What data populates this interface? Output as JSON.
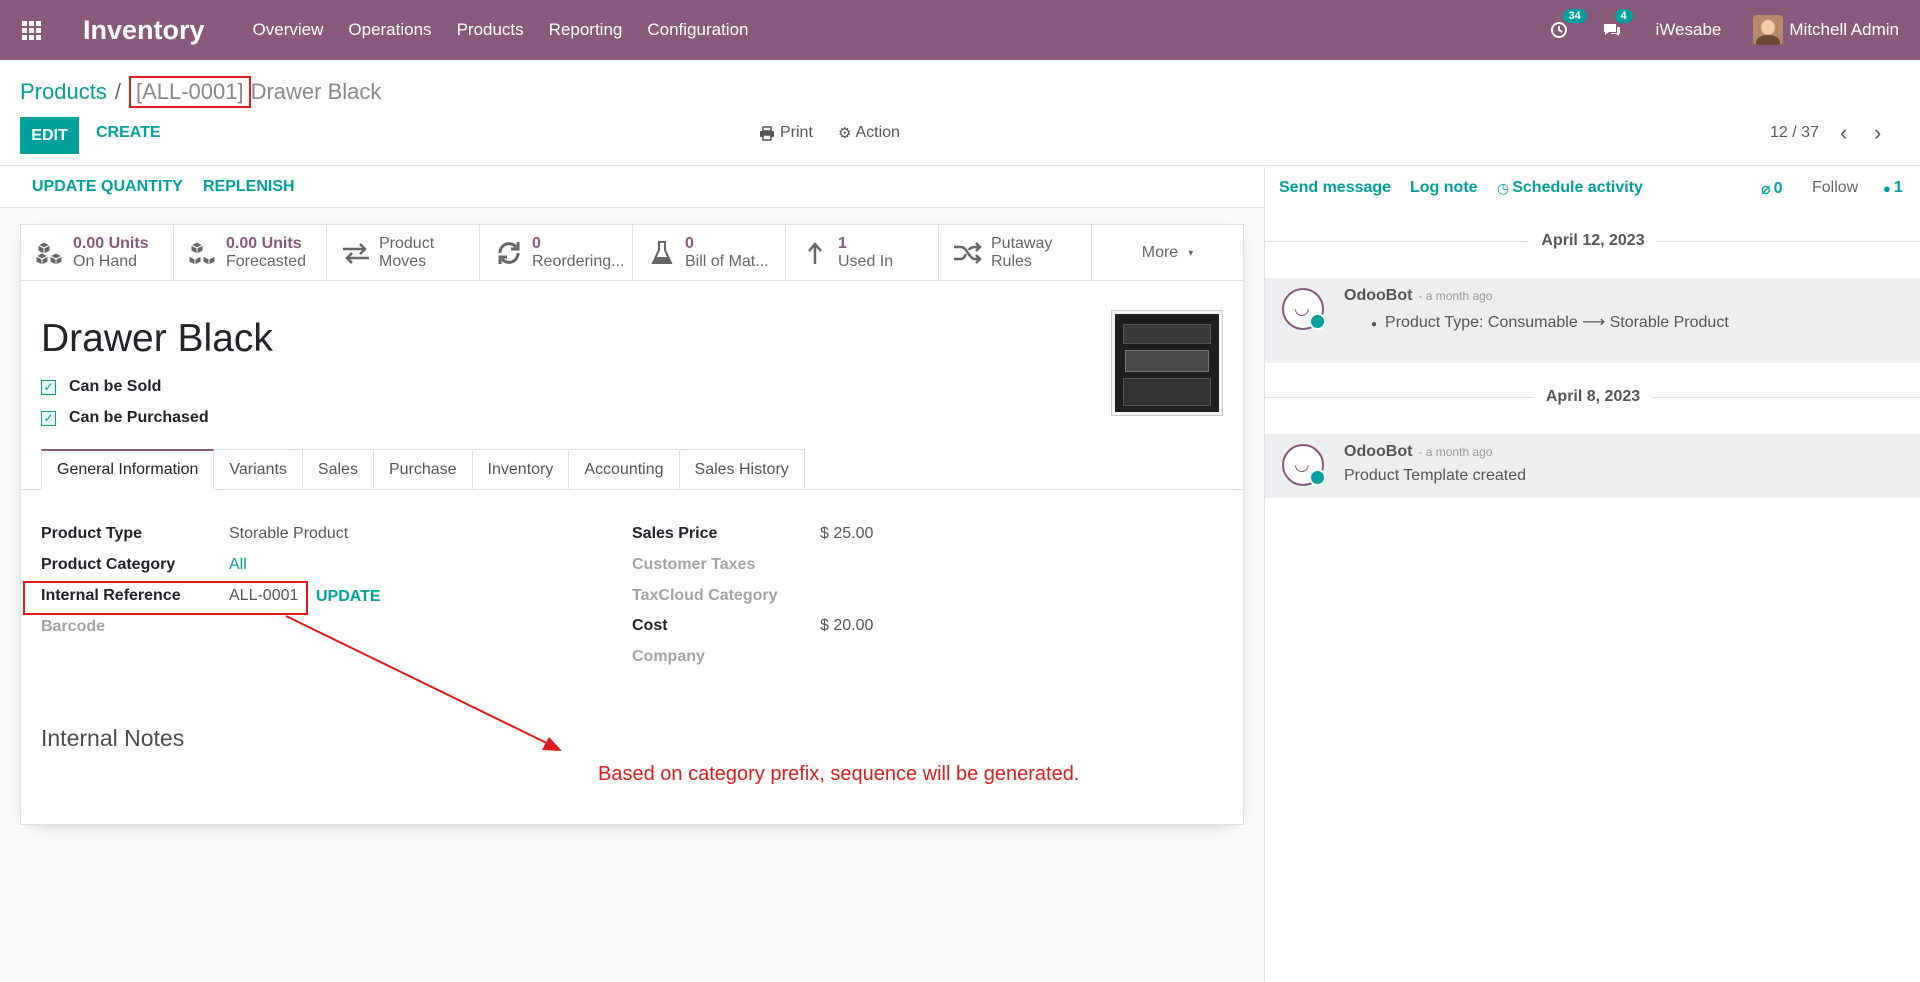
{
  "navbar": {
    "brand": "Inventory",
    "menu": [
      "Overview",
      "Operations",
      "Products",
      "Reporting",
      "Configuration"
    ],
    "activity_count": "34",
    "message_count": "4",
    "company": "iWesabe",
    "user": "Mitchell Admin"
  },
  "breadcrumb": {
    "parent": "Products",
    "separator": "/",
    "reference": "[ALL-0001]",
    "name": "Drawer Black"
  },
  "toolbar": {
    "edit": "EDIT",
    "create": "CREATE",
    "print": "Print",
    "action": "Action",
    "pager": "12 / 37"
  },
  "statusbar": {
    "update_quantity": "UPDATE QUANTITY",
    "replenish": "REPLENISH"
  },
  "smart_buttons": [
    {
      "value": "0.00 Units",
      "label": "On Hand",
      "icon": "cubes-icon"
    },
    {
      "value": "0.00 Units",
      "label": "Forecasted",
      "icon": "cubes-icon"
    },
    {
      "value": "Product",
      "label": "Moves",
      "icon": "exchange-icon"
    },
    {
      "value": "0",
      "label": "Reordering...",
      "icon": "refresh-icon"
    },
    {
      "value": "0",
      "label": "Bill of Mat...",
      "icon": "flask-icon"
    },
    {
      "value": "1",
      "label": "Used In",
      "icon": "level-up-icon"
    },
    {
      "value": "Putaway",
      "label": "Rules",
      "icon": "random-icon"
    },
    {
      "value": "More",
      "label": "",
      "icon": "caret-down-icon"
    }
  ],
  "product": {
    "name": "Drawer Black",
    "can_be_sold": "Can be Sold",
    "can_be_purchased": "Can be Purchased"
  },
  "tabs": [
    "General Information",
    "Variants",
    "Sales",
    "Purchase",
    "Inventory",
    "Accounting",
    "Sales History"
  ],
  "fields": {
    "product_type_label": "Product Type",
    "product_type": "Storable Product",
    "category_label": "Product Category",
    "category": "All",
    "internal_ref_label": "Internal Reference",
    "internal_ref": "ALL-0001",
    "update": "UPDATE",
    "barcode_label": "Barcode",
    "sales_price_label": "Sales Price",
    "sales_price": "$ 25.00",
    "customer_taxes_label": "Customer Taxes",
    "taxcloud_label": "TaxCloud Category",
    "cost_label": "Cost",
    "cost": "$ 20.00",
    "company_label": "Company",
    "internal_notes": "Internal Notes"
  },
  "annotation": "Based on category prefix, sequence will be generated.",
  "chatter": {
    "send_message": "Send message",
    "log_note": "Log note",
    "schedule_activity": "Schedule activity",
    "attachments": "0",
    "follow": "Follow",
    "followers": "1",
    "messages": [
      {
        "date": "April 12, 2023",
        "author": "OdooBot",
        "time": "- a month ago",
        "body": "Product Type: Consumable ⟶ Storable Product"
      },
      {
        "date": "April 8, 2023",
        "author": "OdooBot",
        "time": "- a month ago",
        "body": "Product Template created"
      }
    ]
  },
  "colors": {
    "primary": "#875a7b",
    "accent": "#00a09d",
    "annotation": "#e01b1b"
  }
}
